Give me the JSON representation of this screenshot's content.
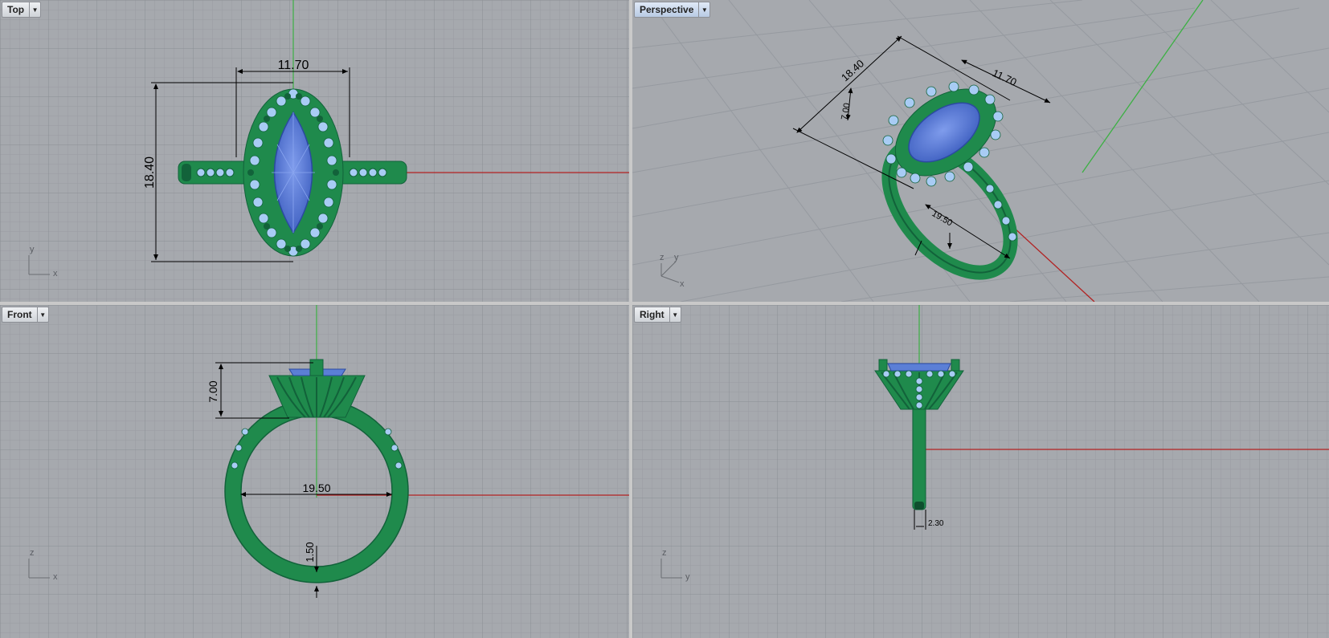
{
  "viewports": {
    "top": {
      "label": "Top"
    },
    "persp": {
      "label": "Perspective"
    },
    "front": {
      "label": "Front"
    },
    "right": {
      "label": "Right"
    }
  },
  "dimensions": {
    "top": {
      "width": "11.70",
      "length": "18.40"
    },
    "persp": {
      "length": "18.40",
      "width": "11.70",
      "height": "7.00",
      "diameter": "19.50"
    },
    "front": {
      "height": "7.00",
      "diameter": "19.50",
      "shank": "1.50"
    },
    "right": {
      "band": "2.30"
    }
  },
  "axes": {
    "top": {
      "a": "y",
      "b": "x"
    },
    "persp": {
      "a": "z",
      "b": "y",
      "c": "x"
    },
    "front": {
      "a": "z",
      "b": "x"
    },
    "right": {
      "a": "z",
      "b": "y"
    }
  },
  "icons": {
    "dropdown": "dropdown-arrow-icon"
  },
  "colors": {
    "viewport_bg": "#a6a9ae",
    "grid_minor": "#9a9da2",
    "grid_major": "#8a8d92",
    "x_axis": "#b22222",
    "y_axis": "#3cb043",
    "metal": "#1f8a4c",
    "metal_dark": "#12623a",
    "gem_center": "#5b7fd6",
    "gem_small": "#a8ccf4",
    "dimension": "#000000"
  }
}
